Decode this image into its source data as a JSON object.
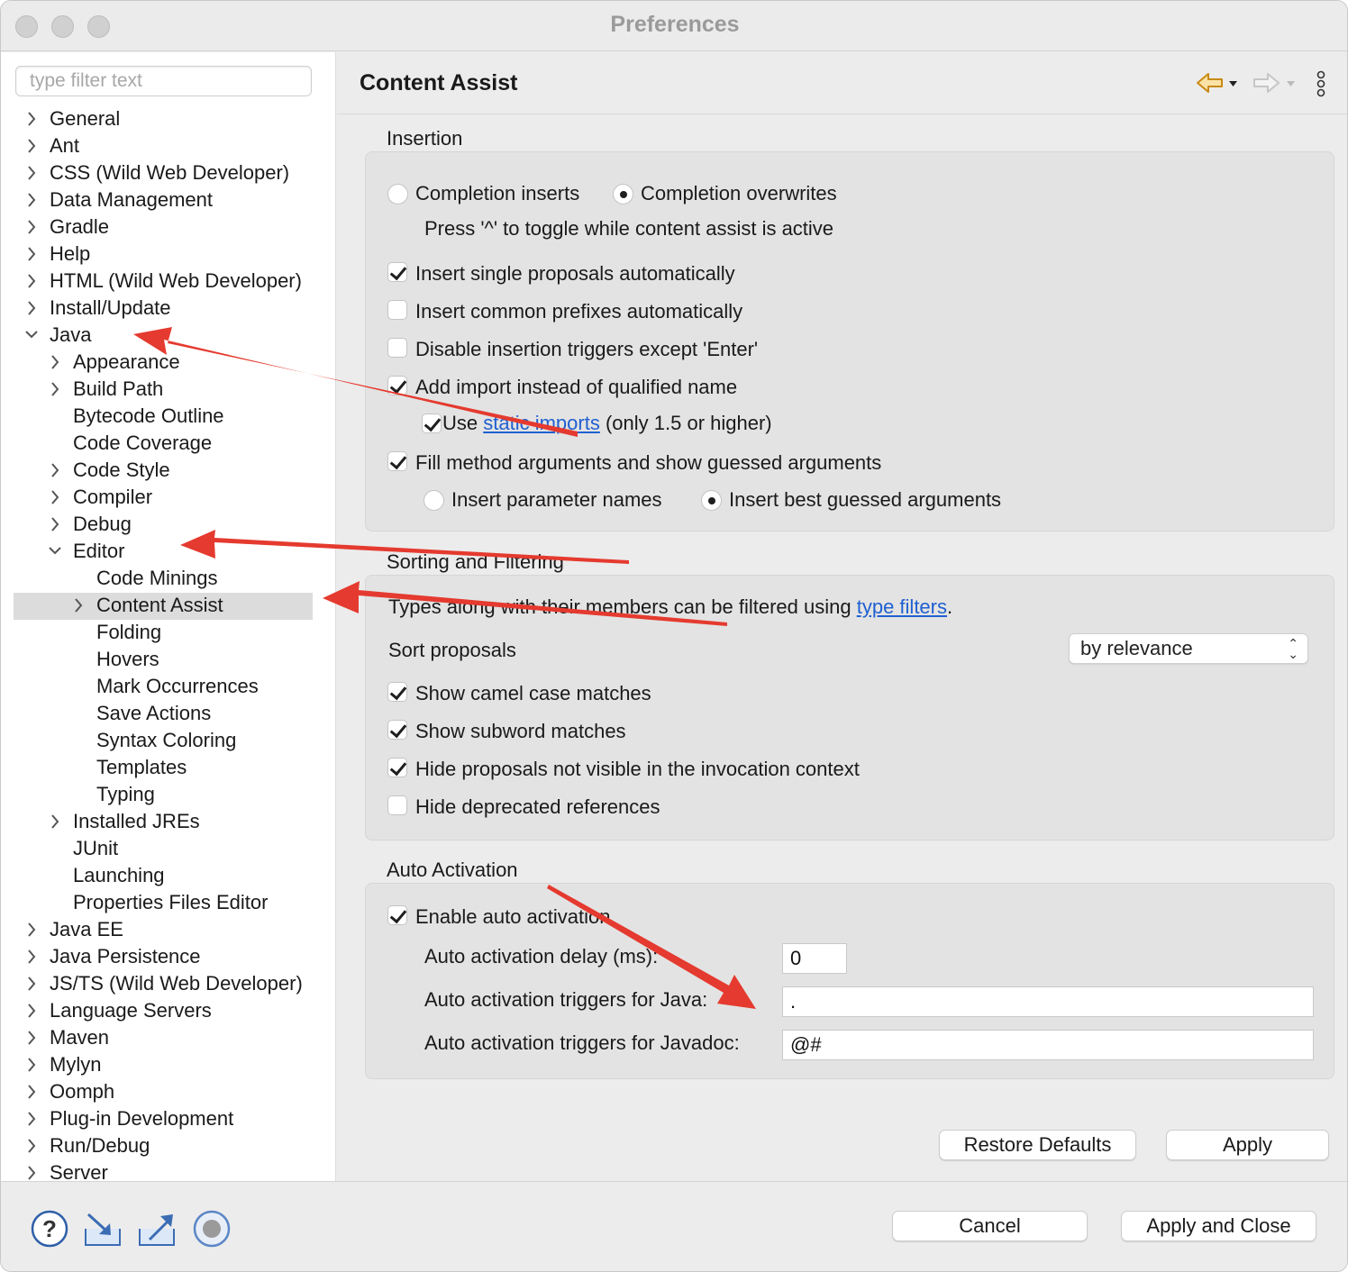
{
  "window": {
    "title": "Preferences"
  },
  "filter": {
    "placeholder": "type filter text"
  },
  "tree": [
    {
      "label": "General",
      "level": 0,
      "chevron": "right"
    },
    {
      "label": "Ant",
      "level": 0,
      "chevron": "right"
    },
    {
      "label": "CSS (Wild Web Developer)",
      "level": 0,
      "chevron": "right"
    },
    {
      "label": "Data Management",
      "level": 0,
      "chevron": "right"
    },
    {
      "label": "Gradle",
      "level": 0,
      "chevron": "right"
    },
    {
      "label": "Help",
      "level": 0,
      "chevron": "right"
    },
    {
      "label": "HTML (Wild Web Developer)",
      "level": 0,
      "chevron": "right"
    },
    {
      "label": "Install/Update",
      "level": 0,
      "chevron": "right"
    },
    {
      "label": "Java",
      "level": 0,
      "chevron": "down"
    },
    {
      "label": "Appearance",
      "level": 1,
      "chevron": "right"
    },
    {
      "label": "Build Path",
      "level": 1,
      "chevron": "right"
    },
    {
      "label": "Bytecode Outline",
      "level": 1,
      "chevron": "none"
    },
    {
      "label": "Code Coverage",
      "level": 1,
      "chevron": "none"
    },
    {
      "label": "Code Style",
      "level": 1,
      "chevron": "right"
    },
    {
      "label": "Compiler",
      "level": 1,
      "chevron": "right"
    },
    {
      "label": "Debug",
      "level": 1,
      "chevron": "right"
    },
    {
      "label": "Editor",
      "level": 1,
      "chevron": "down"
    },
    {
      "label": "Code Minings",
      "level": 2,
      "chevron": "none"
    },
    {
      "label": "Content Assist",
      "level": 2,
      "chevron": "right",
      "selected": true
    },
    {
      "label": "Folding",
      "level": 2,
      "chevron": "none"
    },
    {
      "label": "Hovers",
      "level": 2,
      "chevron": "none"
    },
    {
      "label": "Mark Occurrences",
      "level": 2,
      "chevron": "none"
    },
    {
      "label": "Save Actions",
      "level": 2,
      "chevron": "none"
    },
    {
      "label": "Syntax Coloring",
      "level": 2,
      "chevron": "none"
    },
    {
      "label": "Templates",
      "level": 2,
      "chevron": "none"
    },
    {
      "label": "Typing",
      "level": 2,
      "chevron": "none"
    },
    {
      "label": "Installed JREs",
      "level": 1,
      "chevron": "right"
    },
    {
      "label": "JUnit",
      "level": 1,
      "chevron": "none"
    },
    {
      "label": "Launching",
      "level": 1,
      "chevron": "none"
    },
    {
      "label": "Properties Files Editor",
      "level": 1,
      "chevron": "none"
    },
    {
      "label": "Java EE",
      "level": 0,
      "chevron": "right"
    },
    {
      "label": "Java Persistence",
      "level": 0,
      "chevron": "right"
    },
    {
      "label": "JS/TS (Wild Web Developer)",
      "level": 0,
      "chevron": "right"
    },
    {
      "label": "Language Servers",
      "level": 0,
      "chevron": "right"
    },
    {
      "label": "Maven",
      "level": 0,
      "chevron": "right"
    },
    {
      "label": "Mylyn",
      "level": 0,
      "chevron": "right"
    },
    {
      "label": "Oomph",
      "level": 0,
      "chevron": "right"
    },
    {
      "label": "Plug-in Development",
      "level": 0,
      "chevron": "right"
    },
    {
      "label": "Run/Debug",
      "level": 0,
      "chevron": "right"
    },
    {
      "label": "Server",
      "level": 0,
      "chevron": "right"
    }
  ],
  "page": {
    "title": "Content Assist",
    "icons": {
      "back": "back-arrow-icon",
      "forward": "forward-arrow-icon",
      "menu": "more-options-icon"
    }
  },
  "insertion": {
    "title": "Insertion",
    "completion_inserts": "Completion inserts",
    "completion_overwrites": "Completion overwrites",
    "toggle_hint": "Press '^' to toggle while content assist is active",
    "insert_single": "Insert single proposals automatically",
    "insert_common": "Insert common prefixes automatically",
    "disable_triggers": "Disable insertion triggers except 'Enter'",
    "add_import": "Add import instead of qualified name",
    "use_prefix": "Use",
    "static_imports": "static imports",
    "use_suffix": "(only 1.5 or higher)",
    "fill_method": "Fill method arguments and show guessed arguments",
    "insert_param_names": "Insert parameter names",
    "insert_best_guessed": "Insert best guessed arguments"
  },
  "sorting": {
    "title": "Sorting and Filtering",
    "types_prefix": "Types along with their members can be filtered using",
    "type_filters": "type filters",
    "types_suffix": ".",
    "sort_label": "Sort proposals",
    "sort_value": "by relevance",
    "camel_case": "Show camel case matches",
    "subword": "Show subword matches",
    "hide_not_visible": "Hide proposals not visible in the invocation context",
    "hide_deprecated": "Hide deprecated references"
  },
  "auto_activation": {
    "title": "Auto Activation",
    "enable": "Enable auto activation",
    "delay_label": "Auto activation delay (ms):",
    "delay_value": "0",
    "java_label": "Auto activation triggers for Java:",
    "java_value": ".",
    "javadoc_label": "Auto activation triggers for Javadoc:",
    "javadoc_value": "@#"
  },
  "buttons": {
    "restore_defaults": "Restore Defaults",
    "apply": "Apply",
    "cancel": "Cancel",
    "apply_and_close": "Apply and Close"
  },
  "bottom_icons": [
    "help-icon",
    "import-icon",
    "export-icon",
    "record-icon"
  ],
  "colors": {
    "accent_link": "#2060d0",
    "annotation_arrow": "#e53a2f",
    "selection": "#dcdcdc"
  }
}
